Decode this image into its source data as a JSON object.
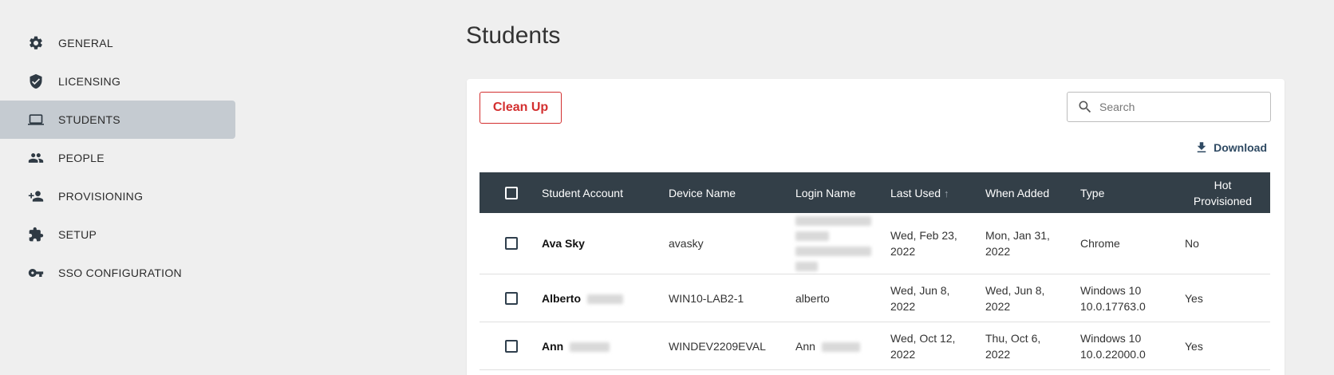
{
  "sidebar": {
    "items": [
      {
        "label": "GENERAL",
        "icon": "gear-icon"
      },
      {
        "label": "LICENSING",
        "icon": "shield-check-icon"
      },
      {
        "label": "STUDENTS",
        "icon": "laptop-icon",
        "active": true
      },
      {
        "label": "PEOPLE",
        "icon": "people-icon"
      },
      {
        "label": "PROVISIONING",
        "icon": "person-add-icon"
      },
      {
        "label": "SETUP",
        "icon": "puzzle-icon"
      },
      {
        "label": "SSO CONFIGURATION",
        "icon": "key-icon"
      }
    ]
  },
  "page": {
    "title": "Students"
  },
  "toolbar": {
    "cleanup_label": "Clean Up",
    "search_placeholder": "Search",
    "download_label": "Download"
  },
  "table": {
    "headers": {
      "account": "Student Account",
      "device": "Device Name",
      "login": "Login Name",
      "last_used": "Last Used",
      "when_added": "When Added",
      "type": "Type",
      "hot_line1": "Hot",
      "hot_line2": "Provisioned"
    },
    "rows": [
      {
        "account": "Ava Sky",
        "device": "avasky",
        "login": "",
        "last_used_1": "Wed, Feb 23,",
        "last_used_2": "2022",
        "added_1": "Mon, Jan 31,",
        "added_2": "2022",
        "type_1": "Chrome",
        "type_2": "",
        "hot": "No"
      },
      {
        "account": "Alberto",
        "device": "WIN10-LAB2-1",
        "login": "alberto",
        "last_used_1": "Wed, Jun 8,",
        "last_used_2": "2022",
        "added_1": "Wed, Jun 8,",
        "added_2": "2022",
        "type_1": "Windows 10",
        "type_2": "10.0.17763.0",
        "hot": "Yes"
      },
      {
        "account": "Ann",
        "device": "WINDEV2209EVAL",
        "login": "Ann",
        "last_used_1": "Wed, Oct 12,",
        "last_used_2": "2022",
        "added_1": "Thu, Oct 6,",
        "added_2": "2022",
        "type_1": "Windows 10",
        "type_2": "10.0.22000.0",
        "hot": "Yes"
      }
    ]
  },
  "colors": {
    "danger": "#d32f2f",
    "header": "#333f48",
    "active_nav": "#c5cbd1"
  }
}
